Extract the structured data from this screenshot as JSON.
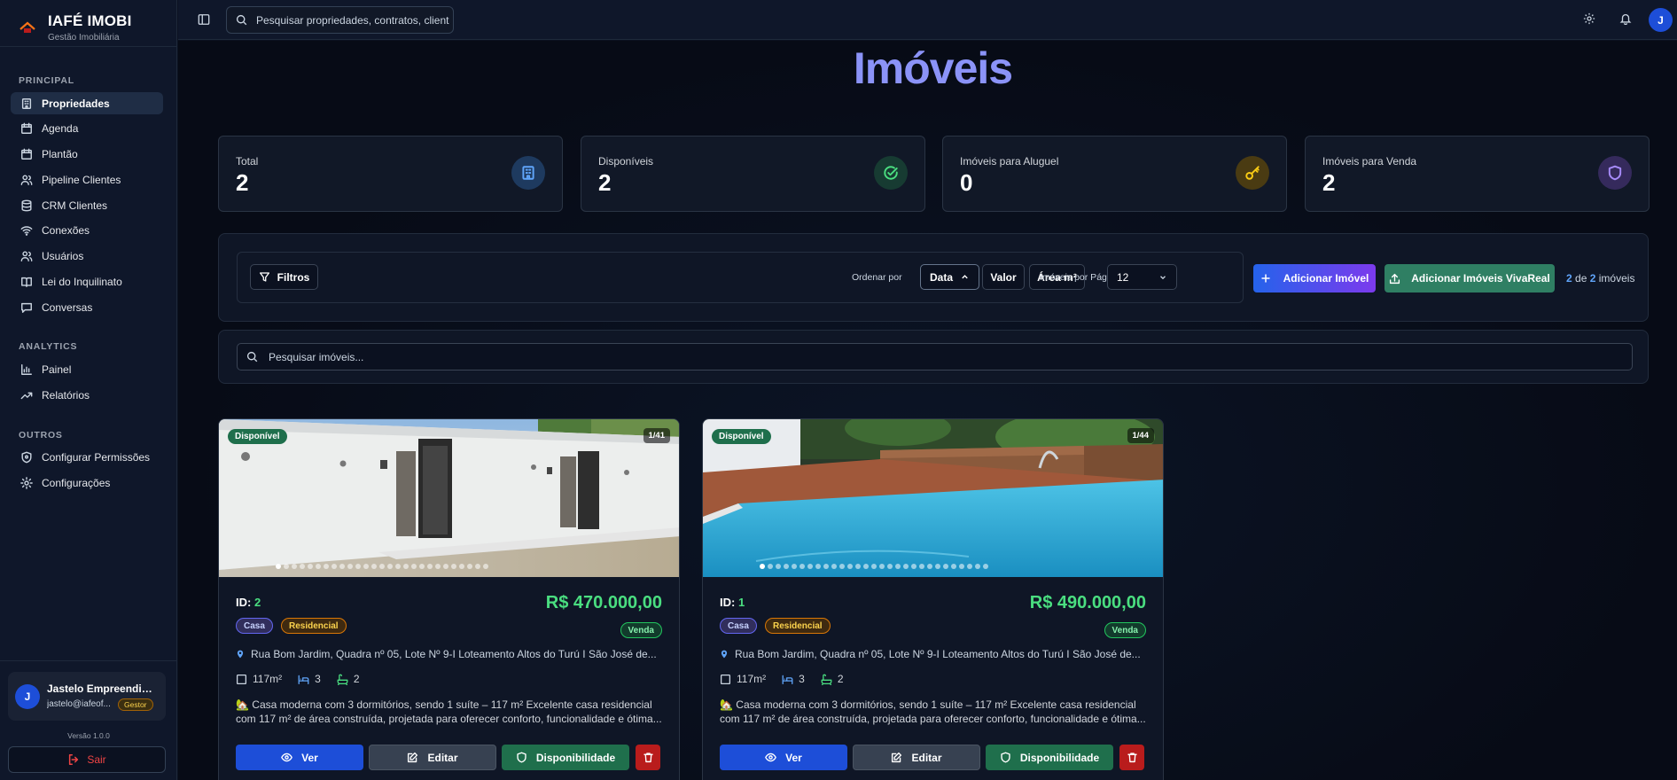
{
  "brand": {
    "title": "IAFÉ IMOBI",
    "subtitle": "Gestão Imobiliária"
  },
  "nav": {
    "sections": [
      {
        "label": "PRINCIPAL",
        "items": [
          {
            "label": "Propriedades",
            "icon": "building-icon",
            "active": true
          },
          {
            "label": "Agenda",
            "icon": "calendar-icon"
          },
          {
            "label": "Plantão",
            "icon": "calendar-icon"
          },
          {
            "label": "Pipeline Clientes",
            "icon": "users-icon"
          },
          {
            "label": "CRM Clientes",
            "icon": "database-icon"
          },
          {
            "label": "Conexões",
            "icon": "wifi-icon"
          },
          {
            "label": "Usuários",
            "icon": "users-icon"
          },
          {
            "label": "Lei do Inquilinato",
            "icon": "book-icon"
          },
          {
            "label": "Conversas",
            "icon": "message-icon"
          }
        ]
      },
      {
        "label": "ANALYTICS",
        "items": [
          {
            "label": "Painel",
            "icon": "bar-chart-icon"
          },
          {
            "label": "Relatórios",
            "icon": "trending-up-icon"
          }
        ]
      },
      {
        "label": "OUTROS",
        "items": [
          {
            "label": "Configurar Permissões",
            "icon": "shield-icon"
          },
          {
            "label": "Configurações",
            "icon": "gear-icon"
          }
        ]
      }
    ]
  },
  "user": {
    "initial": "J",
    "name": "Jastelo Empreendime...",
    "email": "jastelo@iafeof...",
    "role": "Gestor"
  },
  "version": "Versão 1.0.0",
  "logout_label": "Sair",
  "topbar": {
    "search_placeholder": "Pesquisar propriedades, contratos, client",
    "avatar_initial": "J"
  },
  "page": {
    "title": "Imóveis"
  },
  "stats": [
    {
      "label": "Total",
      "value": "2",
      "icon": "building-icon",
      "color": "#60a5fa",
      "bg": "#1e3a5f"
    },
    {
      "label": "Disponíveis",
      "value": "2",
      "icon": "check-circle-icon",
      "color": "#4ade80",
      "bg": "#173b32"
    },
    {
      "label": "Imóveis para Aluguel",
      "value": "0",
      "icon": "key-icon",
      "color": "#facc15",
      "bg": "#4a3b12"
    },
    {
      "label": "Imóveis para Venda",
      "value": "2",
      "icon": "shield-icon",
      "color": "#a78bfa",
      "bg": "#352a5c"
    }
  ],
  "filters": {
    "filtros_label": "Filtros",
    "order_label": "Ordenar por",
    "order_options": [
      "Data",
      "Valor",
      "Área m²"
    ],
    "per_page_label": "Imóveis por Página",
    "per_page_value": "12",
    "add_label": "Adicionar Imóvel",
    "vivareal_label": "Adicionar Imóveis VivaReal",
    "count_shown": "2",
    "count_of": "de",
    "count_total": "2",
    "count_suffix": "imóveis"
  },
  "property_search_placeholder": "Pesquisar imóveis...",
  "cards": [
    {
      "status": "Disponível",
      "image_counter": "1/41",
      "image_index": 1,
      "image_count": 41,
      "visible_dots": 27,
      "id_label": "ID:",
      "id": "2",
      "price": "R$ 470.000,00",
      "type": "Casa",
      "category": "Residencial",
      "business": "Venda",
      "address": "Rua Bom Jardim, Quadra nº 05, Lote Nº 9-I Loteamento Altos do Turú I São José de...",
      "area": "117m²",
      "bedrooms": "3",
      "bathrooms": "2",
      "description": "🏡 Casa moderna com 3 dormitórios, sendo 1 suíte – 117 m² Excelente casa residencial com 117 m² de área construída, projetada para oferecer conforto, funcionalidade e ótima...",
      "actions": {
        "view": "Ver",
        "edit": "Editar",
        "availability": "Disponibilidade"
      }
    },
    {
      "status": "Disponível",
      "image_counter": "1/44",
      "image_index": 1,
      "image_count": 44,
      "visible_dots": 29,
      "id_label": "ID:",
      "id": "1",
      "price": "R$ 490.000,00",
      "type": "Casa",
      "category": "Residencial",
      "business": "Venda",
      "address": "Rua Bom Jardim, Quadra nº 05, Lote Nº 9-I Loteamento Altos do Turú I São José de...",
      "area": "117m²",
      "bedrooms": "3",
      "bathrooms": "2",
      "description": "🏡 Casa moderna com 3 dormitórios, sendo 1 suíte – 117 m² Excelente casa residencial com 117 m² de área construída, projetada para oferecer conforto, funcionalidade e ótima...",
      "actions": {
        "view": "Ver",
        "edit": "Editar",
        "availability": "Disponibilidade"
      }
    }
  ]
}
